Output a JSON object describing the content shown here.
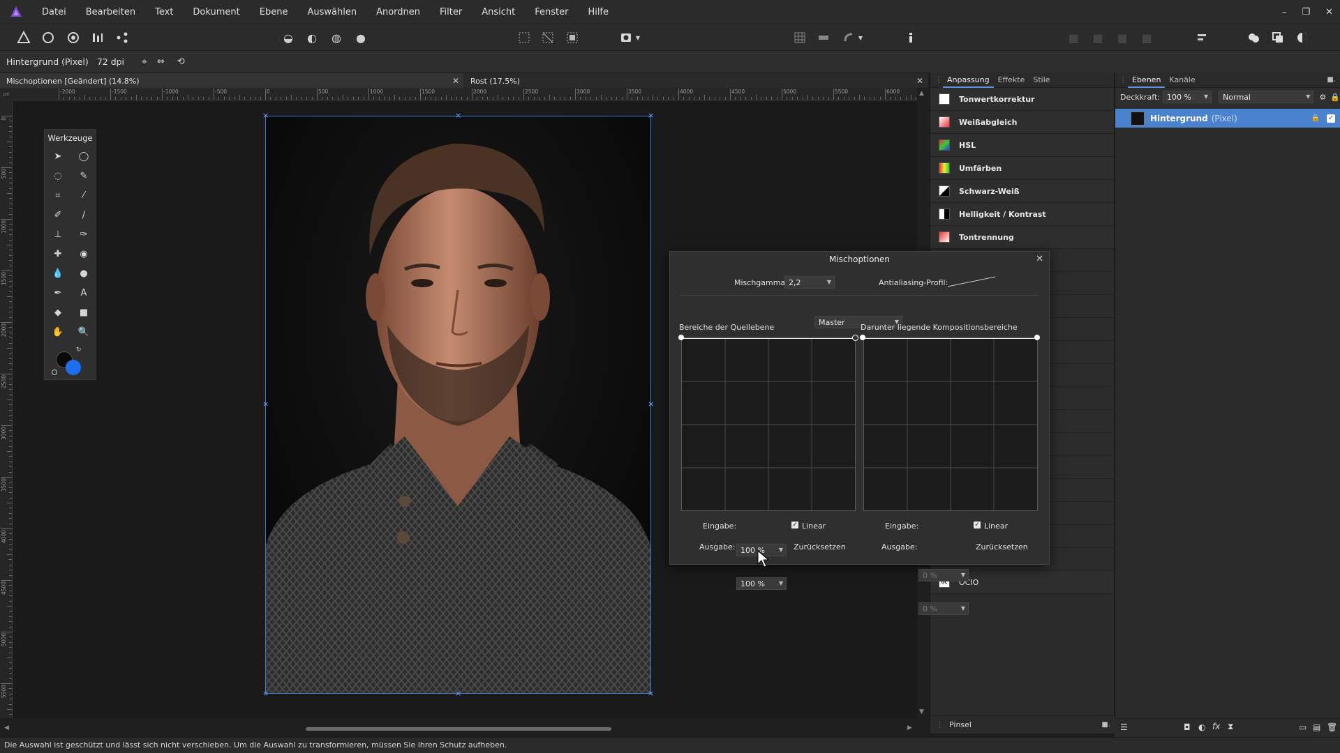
{
  "menu": {
    "items": [
      "Datei",
      "Bearbeiten",
      "Text",
      "Dokument",
      "Ebene",
      "Auswählen",
      "Anordnen",
      "Filter",
      "Ansicht",
      "Fenster",
      "Hilfe"
    ]
  },
  "window_controls": {
    "minimize": "–",
    "restore": "❐",
    "close": "✕"
  },
  "context_bar": {
    "layer_info": "Hintergrund (Pixel)",
    "dpi": "72 dpi"
  },
  "doc_tabs": [
    {
      "label": "Mischoptionen [Geändert] (14.8%)",
      "close": "✕"
    },
    {
      "label": "Rost (17.5%)",
      "close": "✕"
    }
  ],
  "ruler": {
    "unit": "px",
    "h_labels": [
      "-2000",
      "-1500",
      "-1000",
      "-500",
      "0",
      "500",
      "1000",
      "1500",
      "2000",
      "2500",
      "3000",
      "3500",
      "4000",
      "4500",
      "5000",
      "5500",
      "6000"
    ],
    "v_labels": [
      "0",
      "500",
      "1000",
      "1500",
      "2000",
      "2500",
      "3000",
      "3500",
      "4000",
      "4500",
      "5000",
      "5500"
    ]
  },
  "tools": {
    "title": "Werkzeuge"
  },
  "status_bar": {
    "message": "Die Auswahl ist geschützt und lässt sich nicht verschieben. Um die Auswahl zu transformieren, müssen Sie ihren Schutz aufheben."
  },
  "adjustments": {
    "tabs": [
      "Anpassung",
      "Effekte",
      "Stile"
    ],
    "items": [
      {
        "label": "Tonwertkorrektur",
        "icon": "levels-icon"
      },
      {
        "label": "Weißabgleich",
        "icon": "white-balance-icon"
      },
      {
        "label": "HSL",
        "icon": "hsl-icon"
      },
      {
        "label": "Umfärben",
        "icon": "recolor-icon"
      },
      {
        "label": "Schwarz-Weiß",
        "icon": "black-white-icon"
      },
      {
        "label": "Helligkeit / Kontrast",
        "icon": "brightness-contrast-icon"
      },
      {
        "label": "Tontrennung",
        "icon": "posterize-icon"
      }
    ],
    "last_item": "OCIO",
    "bottom_tab": "Pinsel"
  },
  "layers": {
    "tabs": [
      "Ebenen",
      "Kanäle"
    ],
    "opacity_label": "Deckkraft:",
    "opacity_value": "100 %",
    "blend_mode": "Normal",
    "layer_name": "Hintergrund",
    "layer_type": "(Pixel)"
  },
  "dialog": {
    "title": "Mischoptionen",
    "gamma_label": "Mischgamma:",
    "gamma_value": "2,2",
    "antialias_label": "Antialiasing-Profil:",
    "channel": "Master",
    "source_label": "Bereiche der Quellebene",
    "underlying_label": "Darunter liegende Kompositionsbereiche",
    "left": {
      "input_label": "Eingabe:",
      "input_value": "100 %",
      "output_label": "Ausgabe:",
      "output_value": "100 %",
      "linear_label": "Linear",
      "reset_label": "Zurücksetzen"
    },
    "right": {
      "input_label": "Eingabe:",
      "input_value": "0 %",
      "output_label": "Ausgabe:",
      "output_value": "0 %",
      "linear_label": "Linear",
      "reset_label": "Zurücksetzen"
    }
  },
  "colors": {
    "accent": "#4a82cf",
    "selection": "#3f7bd8",
    "fg_swatch": "#0a0a0a",
    "bg_swatch": "#1e6ff0"
  }
}
